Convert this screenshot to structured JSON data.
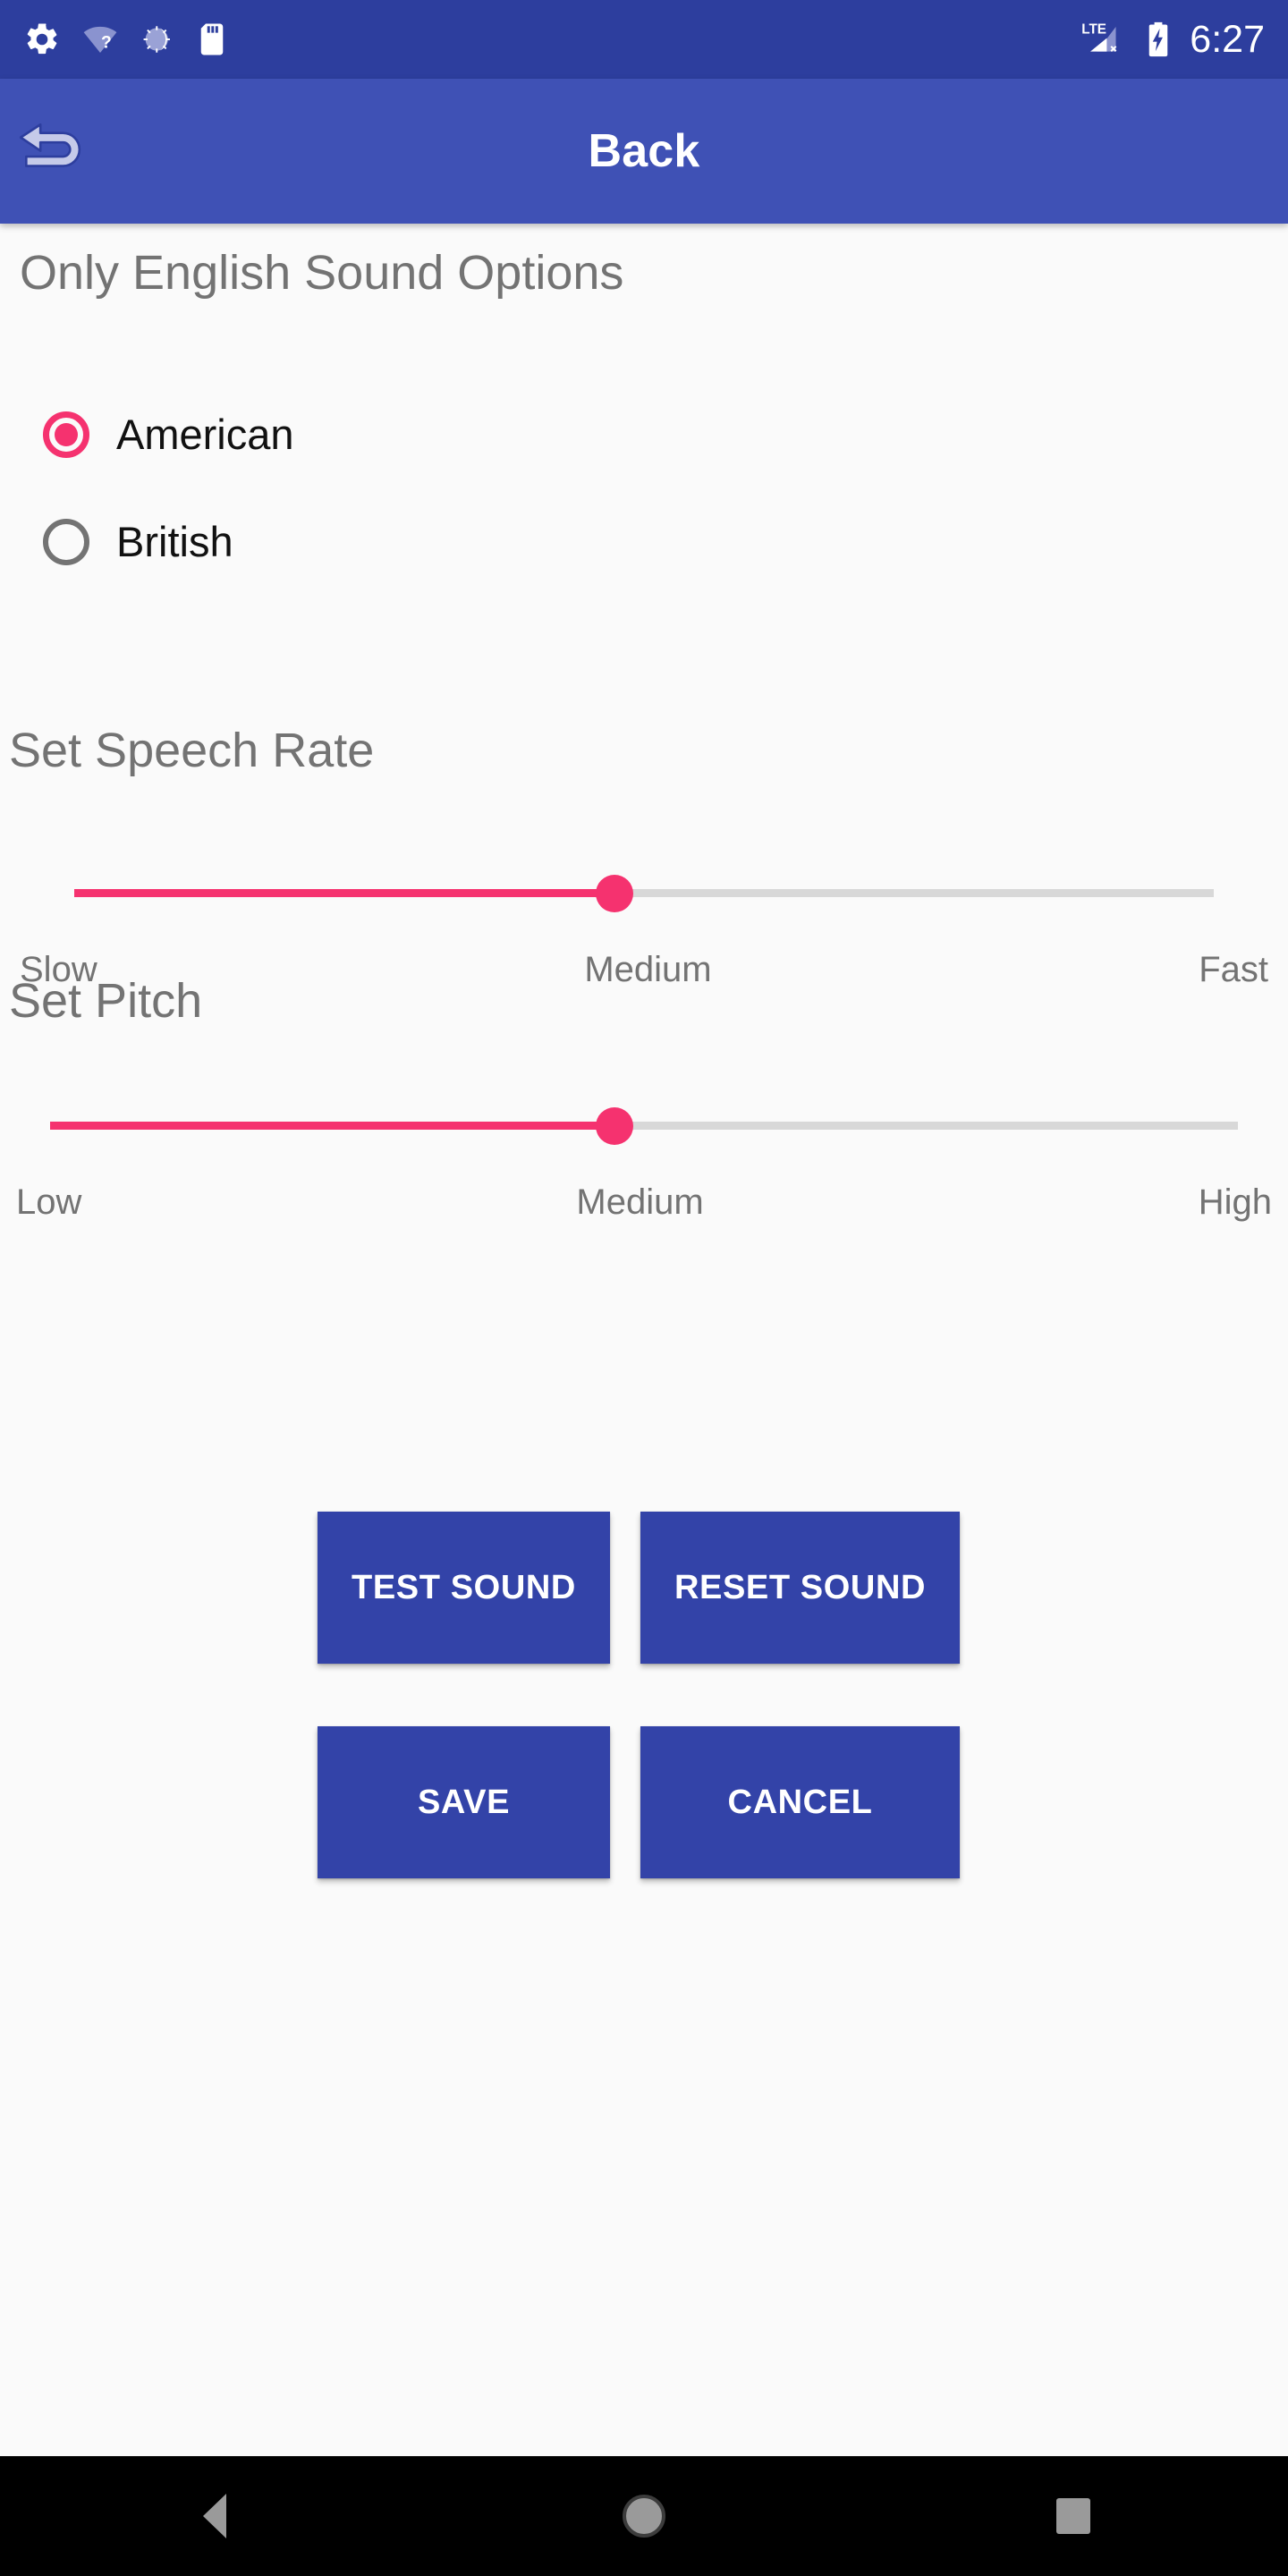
{
  "status_bar": {
    "background": "#2D3E9E",
    "clock": "6:27",
    "left_icons": [
      {
        "name": "settings-gear-icon"
      },
      {
        "name": "wifi-unknown-icon"
      },
      {
        "name": "sync-loading-icon"
      },
      {
        "name": "sd-card-icon"
      }
    ],
    "right_icons": [
      {
        "name": "lte-signal-no-service-icon",
        "label": "LTE"
      },
      {
        "name": "battery-charging-icon"
      }
    ]
  },
  "app_bar": {
    "background": "#3F51B5",
    "title": "Back",
    "back_icon": "back-undo-arrow-icon"
  },
  "sound_options": {
    "heading": "Only English Sound Options",
    "accent_color": "#F5326F",
    "options": [
      {
        "label": "American",
        "selected": true
      },
      {
        "label": "British",
        "selected": false
      }
    ]
  },
  "speech_rate": {
    "heading": "Set Speech Rate",
    "value_percent": 47,
    "labels": {
      "min": "Slow",
      "mid": "Medium",
      "max": "Fast"
    }
  },
  "pitch": {
    "heading": "Set Pitch",
    "value_percent": 48,
    "labels": {
      "min": "Low",
      "mid": "Medium",
      "max": "High"
    }
  },
  "buttons": {
    "color": "#3343A8",
    "test_sound": "TEST SOUND",
    "reset_sound": "RESET SOUND",
    "save": "SAVE",
    "cancel": "CANCEL"
  },
  "nav_bar": {
    "background": "#000000",
    "back": "nav-back-triangle-icon",
    "home": "nav-home-circle-icon",
    "recents": "nav-recents-square-icon"
  }
}
